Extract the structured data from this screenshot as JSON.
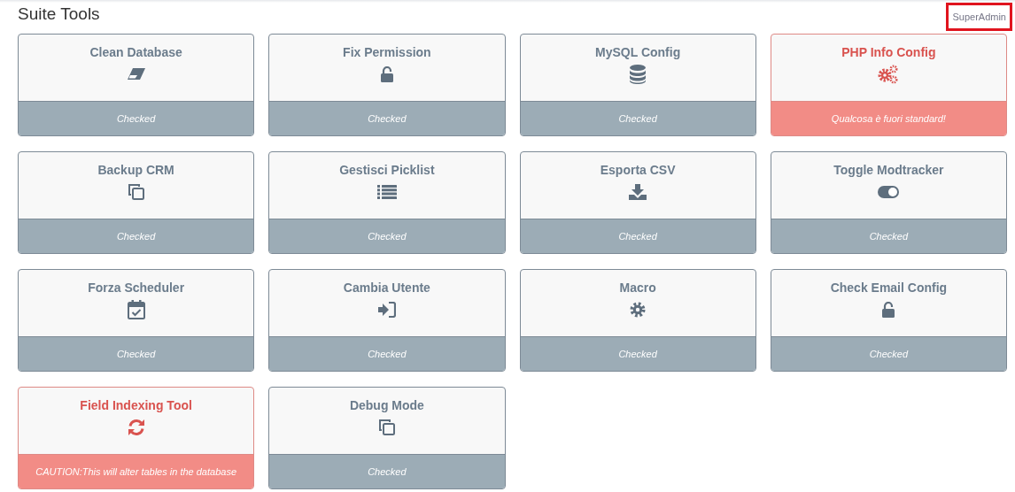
{
  "title": "Suite Tools",
  "user_link": "SuperAdmin",
  "tools": [
    {
      "name": "Clean Database",
      "kind": "ok",
      "message": "Checked"
    },
    {
      "name": "Fix Permission",
      "kind": "ok",
      "message": "Checked"
    },
    {
      "name": "MySQL Config",
      "kind": "ok",
      "message": "Checked"
    },
    {
      "name": "PHP Info Config",
      "kind": "warning",
      "message": "Qualcosa è fuori standard!"
    },
    {
      "name": "Backup CRM",
      "kind": "ok",
      "message": "Checked"
    },
    {
      "name": "Gestisci Picklist",
      "kind": "ok",
      "message": "Checked"
    },
    {
      "name": "Esporta CSV",
      "kind": "ok",
      "message": "Checked"
    },
    {
      "name": "Toggle Modtracker",
      "kind": "ok",
      "message": "Checked"
    },
    {
      "name": "Forza Scheduler",
      "kind": "ok",
      "message": "Checked"
    },
    {
      "name": "Cambia Utente",
      "kind": "ok",
      "message": "Checked"
    },
    {
      "name": "Macro",
      "kind": "ok",
      "message": "Checked"
    },
    {
      "name": "Check Email Config",
      "kind": "ok",
      "message": "Checked"
    },
    {
      "name": "Field Indexing Tool",
      "kind": "warning",
      "message": "CAUTION:This will alter tables in the database"
    },
    {
      "name": "Debug Mode",
      "kind": "ok",
      "message": "Checked"
    }
  ]
}
